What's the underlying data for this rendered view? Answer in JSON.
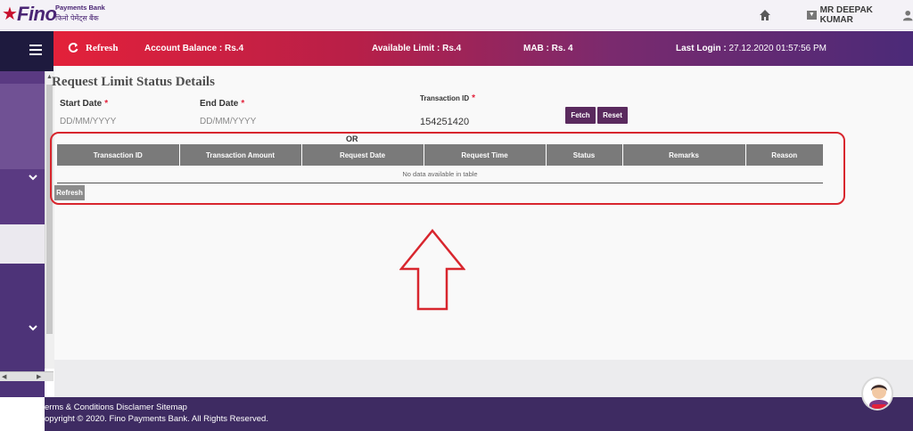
{
  "brand": {
    "name": "Fino",
    "tagline": "Payments Bank",
    "tagline_hindi": "फिनो पेमेंट्स बैंक"
  },
  "header": {
    "user_name": "MR DEEPAK KUMAR"
  },
  "infobar": {
    "refresh_label": "Refresh",
    "account_balance": "Account Balance : Rs.4",
    "available_limit": "Available Limit : Rs.4",
    "mab": "MAB : Rs. 4",
    "last_login_label": "Last Login : ",
    "last_login_value": "27.12.2020 01:57:56 PM"
  },
  "page": {
    "title": "Request Limit Status Details",
    "start_date_label": "Start Date",
    "start_date_value": "DD/MM/YYYY",
    "end_date_label": "End Date",
    "end_date_value": "DD/MM/YYYY",
    "transaction_id_label": "Transaction ID",
    "transaction_id_value": "154251420",
    "required_mark": "*",
    "fetch_label": "Fetch",
    "reset_label": "Reset",
    "or_label": "OR",
    "table_headers": [
      "Transaction ID",
      "Transaction Amount",
      "Request Date",
      "Request Time",
      "Status",
      "Remarks",
      "Reason"
    ],
    "empty_message": "No data available in table",
    "refresh_label": "Refresh"
  },
  "footer": {
    "links": "erms & Conditions Disclamer Sitemap",
    "copyright": "opyright © 2020. Fino Payments Bank. All Rights Reserved."
  },
  "colors": {
    "brand_purple": "#4a2574",
    "accent_red": "#e3213a",
    "button_purple": "#5a2a5e",
    "highlight_red": "#d8262e"
  }
}
